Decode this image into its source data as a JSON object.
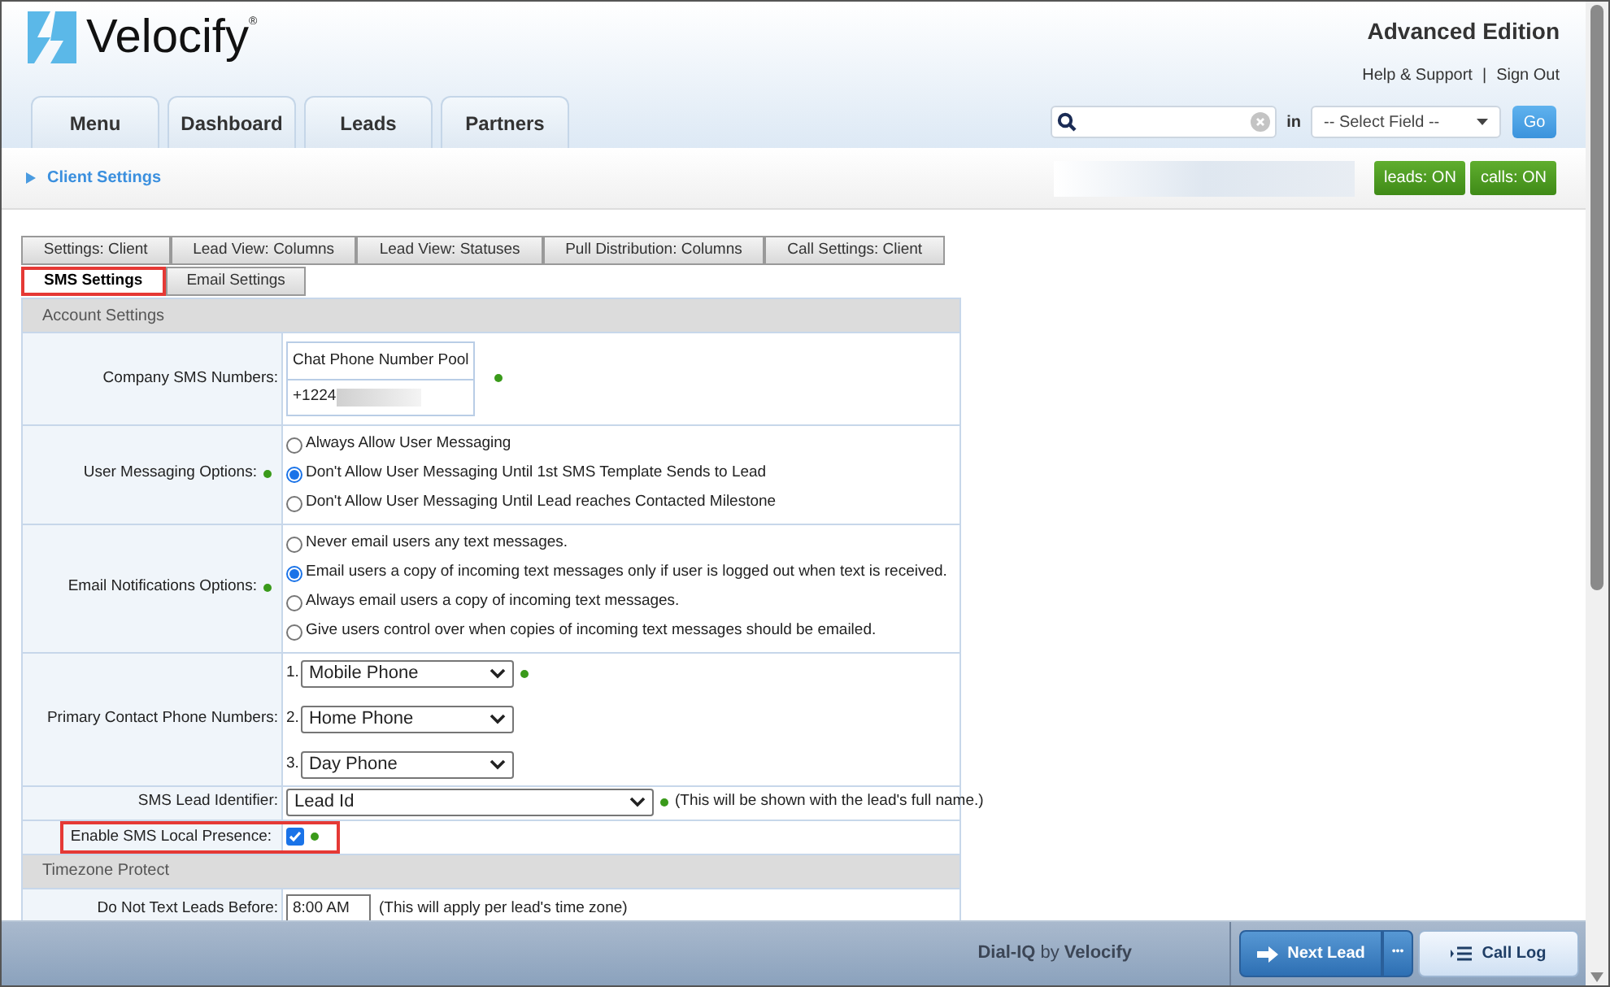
{
  "header": {
    "logo": "Velocify",
    "logo_mark": "®",
    "edition": "Advanced Edition",
    "links": [
      "Help & Support",
      "Sign Out"
    ],
    "link_separator": "|"
  },
  "nav_tabs": [
    {
      "label": "Menu"
    },
    {
      "label": "Dashboard"
    },
    {
      "label": "Leads"
    },
    {
      "label": "Partners"
    }
  ],
  "search": {
    "in_label": "in",
    "field_select": "-- Select Field --",
    "go": "Go"
  },
  "breadcrumb": "Client Settings",
  "toggles": [
    {
      "label": "leads: ON",
      "on": true
    },
    {
      "label": "calls: ON",
      "on": true
    }
  ],
  "settings_tabs": [
    {
      "label": "Settings: Client",
      "selected": false,
      "highlighted": false
    },
    {
      "label": "Lead View: Columns",
      "selected": false,
      "highlighted": false
    },
    {
      "label": "Lead View: Statuses",
      "selected": false,
      "highlighted": false
    },
    {
      "label": "Pull Distribution: Columns",
      "selected": false,
      "highlighted": false
    },
    {
      "label": "Call Settings: Client",
      "selected": false,
      "highlighted": false
    },
    {
      "label": "SMS Settings",
      "selected": true,
      "highlighted": true
    },
    {
      "label": "Email Settings",
      "selected": false,
      "highlighted": false
    }
  ],
  "sections": [
    {
      "title": "Account Settings",
      "rows": [
        {
          "kind": "pool",
          "label": "Company SMS Numbers:",
          "pool_title": "Chat Phone Number Pool",
          "number": "+1224",
          "highlighted": false
        },
        {
          "kind": "radios",
          "label": "User Messaging Options:",
          "highlighted": false,
          "options": [
            {
              "label": "Always Allow User Messaging",
              "selected": false
            },
            {
              "label": "Don't Allow User Messaging Until 1st SMS Template Sends to Lead",
              "selected": true
            },
            {
              "label": "Don't Allow User Messaging Until Lead reaches Contacted Milestone",
              "selected": false
            }
          ]
        },
        {
          "kind": "radios",
          "label": "Email Notifications Options:",
          "highlighted": false,
          "options": [
            {
              "label": "Never email users any text messages.",
              "selected": false
            },
            {
              "label": "Email users a copy of incoming text messages only if user is logged out when text is received.",
              "selected": true
            },
            {
              "label": "Always email users a copy of incoming text messages.",
              "selected": false
            },
            {
              "label": "Give users control over when copies of incoming text messages should be emailed.",
              "selected": false
            }
          ]
        },
        {
          "kind": "phones",
          "label": "Primary Contact Phone Numbers:",
          "highlighted": false,
          "selects": [
            {
              "number": "1.",
              "value": "Mobile Phone"
            },
            {
              "number": "2.",
              "value": "Home Phone"
            },
            {
              "number": "3.",
              "value": "Day Phone"
            }
          ]
        },
        {
          "kind": "select",
          "label": "SMS Lead Identifier:",
          "value": "Lead Id",
          "note": "(This will be shown with the lead's full name.)",
          "highlighted": false
        },
        {
          "kind": "checkbox",
          "label": "Enable SMS Local Presence:",
          "checked": true,
          "highlighted": true
        }
      ]
    },
    {
      "title": "Timezone Protect",
      "rows": [
        {
          "kind": "time",
          "label": "Do Not Text Leads Before:",
          "value": "8:00 AM",
          "note": "(This will apply per lead's time zone)",
          "highlighted": false
        }
      ]
    }
  ],
  "footer": {
    "brand": "**Dial-IQ** by **Velocify**",
    "next_lead": "Next Lead",
    "more": "•••",
    "call_log": "Call Log"
  }
}
